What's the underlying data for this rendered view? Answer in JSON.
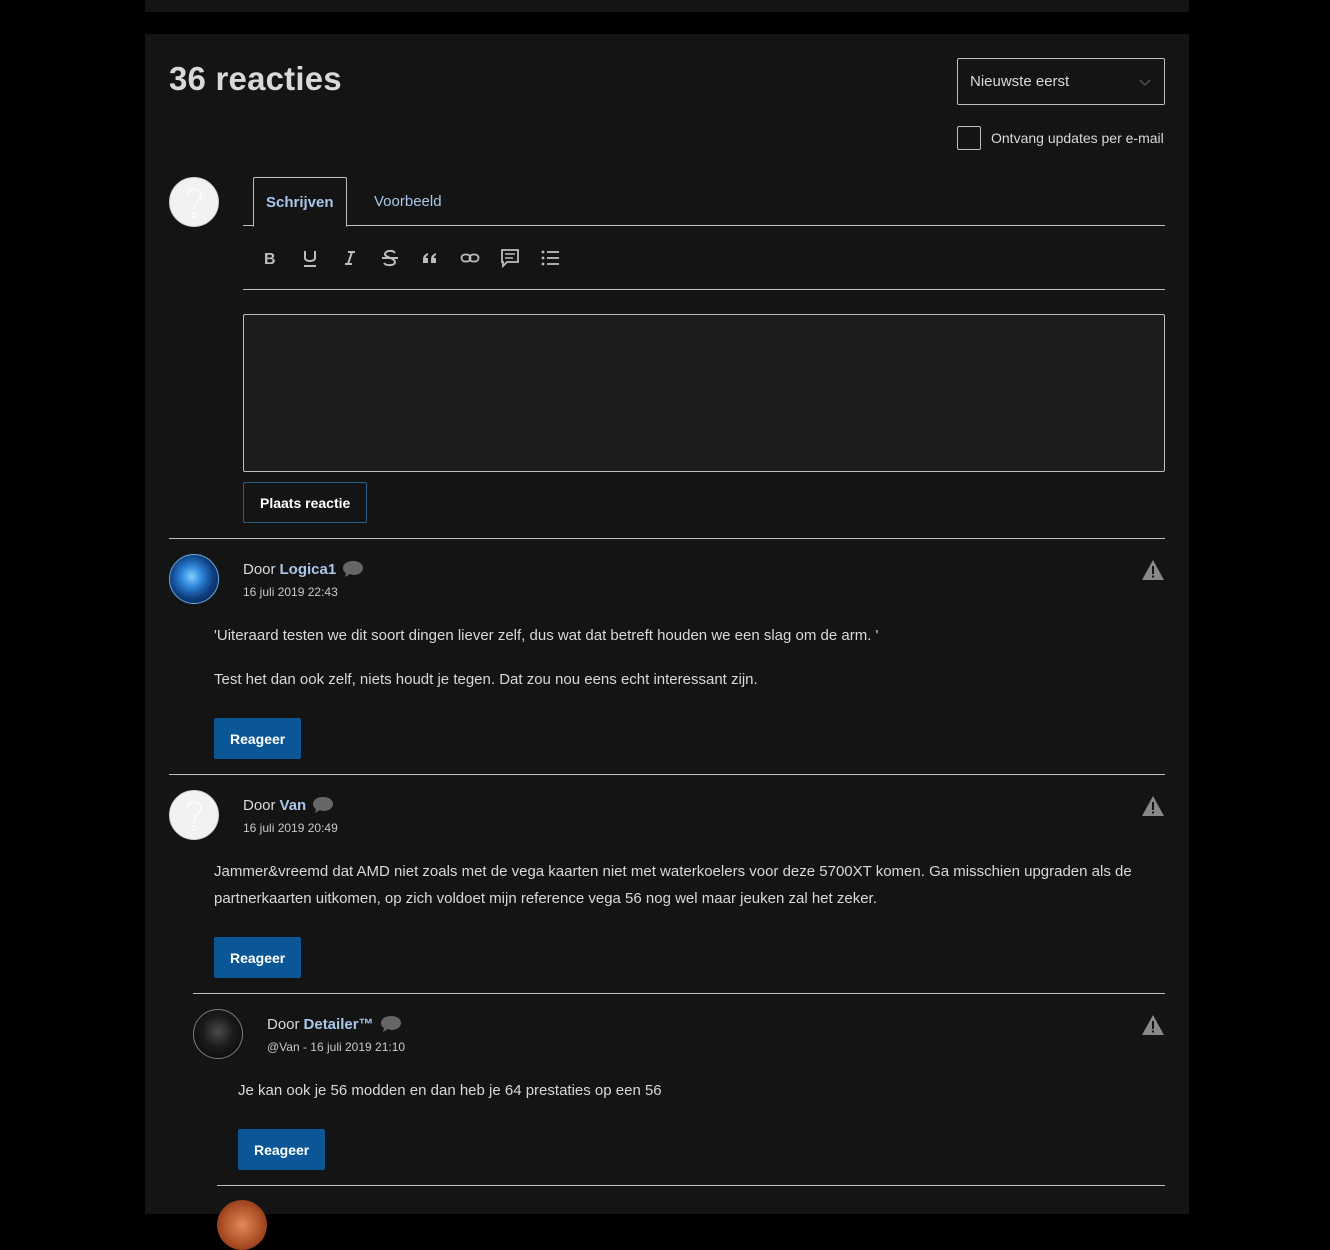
{
  "header": {
    "count_title": "36 reacties",
    "sort": {
      "selected": "Nieuwste eerst",
      "icon": "chevron-down-icon"
    },
    "subscribe_label": "Ontvang updates per e-mail"
  },
  "editor": {
    "tabs": [
      {
        "label": "Schrijven",
        "active": true
      },
      {
        "label": "Voorbeeld",
        "active": false
      }
    ],
    "toolbar": [
      "bold-icon",
      "underline-icon",
      "italic-icon",
      "strikethrough-icon",
      "quote-icon",
      "link-icon",
      "comment-icon",
      "list-icon"
    ],
    "textarea_value": "",
    "submit_label": "Plaats reactie"
  },
  "comments": [
    {
      "by_prefix": "Door",
      "author": "Logica1",
      "date": "16 juli 2019 22:43",
      "paragraphs": [
        "'Uiteraard testen we dit soort dingen liever zelf, dus wat dat betreft houden we een slag om de arm. '",
        "Test het dan ook zelf, niets houdt je tegen. Dat zou nou eens echt interessant zijn."
      ],
      "reply_label": "Reageer"
    },
    {
      "by_prefix": "Door",
      "author": "Van",
      "date": "16 juli 2019 20:49",
      "paragraphs": [
        "Jammer&vreemd dat AMD niet zoals met de vega kaarten niet met waterkoelers voor deze 5700XT komen. Ga misschien upgraden als de partnerkaarten uitkomen, op zich voldoet mijn reference vega 56 nog wel maar jeuken zal het zeker."
      ],
      "reply_label": "Reageer"
    },
    {
      "by_prefix": "Door",
      "author": "Detailer™",
      "date": "@Van - 16 juli 2019 21:10",
      "paragraphs": [
        "Je kan ook je 56 modden en dan heb je 64 prestaties op een 56"
      ],
      "reply_label": "Reageer"
    }
  ],
  "colors": {
    "page_bg": "#000000",
    "panel_bg": "#141414",
    "link": "#a9c7ea",
    "primary_button": "#0a5696",
    "text": "#d9d9d9"
  }
}
